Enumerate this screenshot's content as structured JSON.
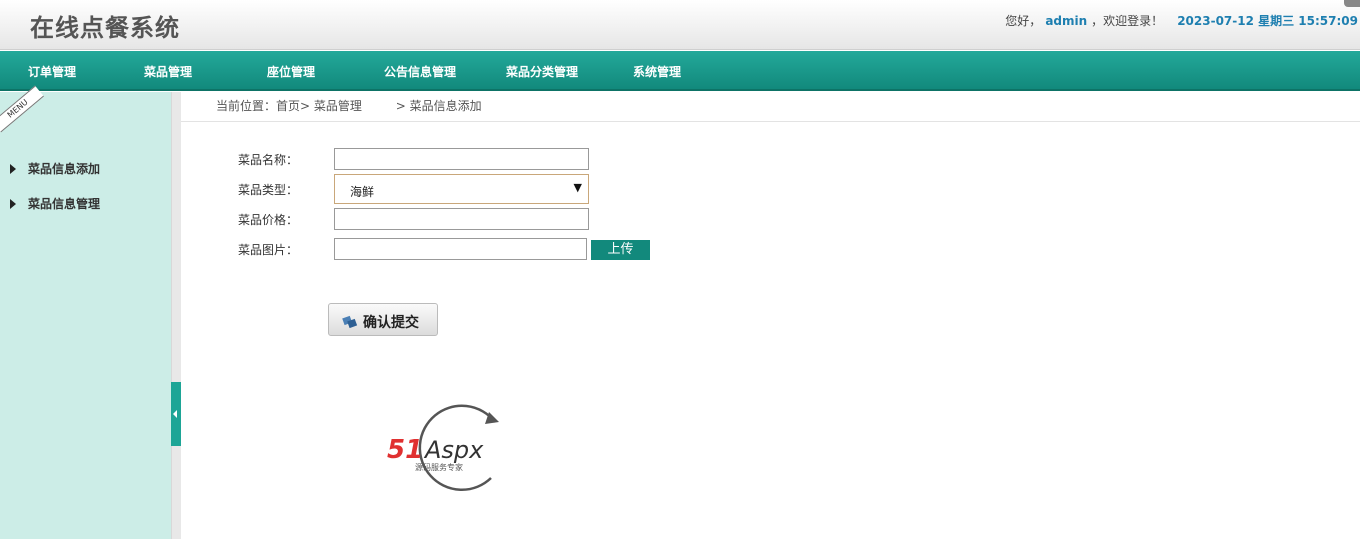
{
  "header": {
    "app_title": "在线点餐系统",
    "greeting_prefix": "您好，",
    "username": "admin",
    "greeting_suffix": "，欢迎登录！",
    "datetime": "2023-07-12 星期三 15:57:09"
  },
  "nav": {
    "items": [
      "订单管理",
      "菜品管理",
      "座位管理",
      "公告信息管理",
      "菜品分类管理",
      "系统管理"
    ]
  },
  "sidebar": {
    "menu_label": "MENU",
    "items": [
      "菜品信息添加",
      "菜品信息管理"
    ]
  },
  "breadcrumb": {
    "prefix": "当前位置：首页>",
    "section": "菜品管理",
    "current": "> 菜品信息添加"
  },
  "form": {
    "name_label": "菜品名称：",
    "name_value": "",
    "type_label": "菜品类型：",
    "type_selected": "海鲜",
    "price_label": "菜品价格：",
    "price_value": "",
    "image_label": "菜品图片：",
    "image_value": "",
    "upload_label": "上传",
    "submit_label": "确认提交"
  },
  "logo": {
    "brand": "51Aspx",
    "tagline": "源码服务专家"
  },
  "colors": {
    "nav": "#1a9d8f",
    "sidebar": "#ccede7",
    "link": "#1e7fb0"
  }
}
